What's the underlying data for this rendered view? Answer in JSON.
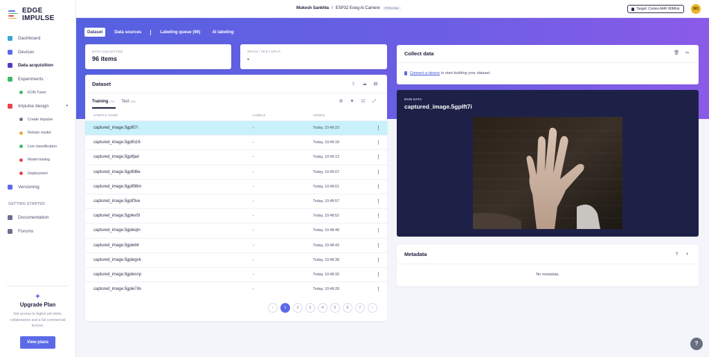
{
  "app": {
    "name": "EDGE IMPULSE"
  },
  "sidebar": {
    "items": [
      {
        "label": "Dashboard",
        "icon": "monitor-icon",
        "color": "#3aa6d9"
      },
      {
        "label": "Devices",
        "icon": "device-icon",
        "color": "#5b6be8"
      },
      {
        "label": "Data acquisition",
        "icon": "database-icon",
        "color": "#4b3fbf",
        "active": true
      },
      {
        "label": "Experiments",
        "icon": "table-icon",
        "color": "#3fb86b"
      },
      {
        "label": "EON Tuner",
        "icon": "eon-icon",
        "color": "#3fb86b",
        "sub": true
      },
      {
        "label": "Impulse design",
        "icon": "pulse-icon",
        "color": "#e8434b",
        "caret": "▾"
      },
      {
        "label": "Create impulse",
        "icon": "dot-icon",
        "color": "#6a6f8e",
        "sub": true
      },
      {
        "label": "Retrain model",
        "icon": "shuffle-icon",
        "color": "#e8a93a",
        "sub": true
      },
      {
        "label": "Live classification",
        "icon": "nodes-icon",
        "color": "#3fb86b",
        "sub": true
      },
      {
        "label": "Model testing",
        "icon": "clipboard-icon",
        "color": "#e8434b",
        "sub": true
      },
      {
        "label": "Deployment",
        "icon": "box-icon",
        "color": "#e8434b",
        "sub": true
      },
      {
        "label": "Versioning",
        "icon": "branch-icon",
        "color": "#5b6be8"
      }
    ],
    "section_label": "GETTING STARTED",
    "getting_started": [
      {
        "label": "Documentation",
        "icon": "book-icon"
      },
      {
        "label": "Forums",
        "icon": "chat-icon"
      }
    ],
    "upgrade": {
      "title": "Upgrade Plan",
      "text": "Get access to higher job limits, collaborators and a full commercial license.",
      "button": "View plans"
    }
  },
  "header": {
    "user": "Mukesh Sankhla",
    "separator": "/",
    "project": "ESP32 Eoeg Ai Camere",
    "badge": "PERSONAL",
    "target": "Target: Cortex-M4F 80MHz",
    "avatar_initials": "MS"
  },
  "tabs": [
    {
      "label": "Dataset",
      "active": true
    },
    {
      "label": "Data sources"
    },
    {
      "label": "Labeling queue (96)"
    },
    {
      "label": "AI labeling"
    }
  ],
  "stats": {
    "collected_label": "DATA COLLECTED",
    "collected_value": "96 items",
    "split_label": "TRAIN / TEST SPLIT",
    "split_value": "-"
  },
  "dataset": {
    "title": "Dataset",
    "training_label": "Training",
    "training_count": "(71)",
    "test_label": "Test",
    "test_count": "(15)",
    "columns": [
      "SAMPLE NAME",
      "LABELS",
      "ADDED"
    ],
    "rows": [
      {
        "name": "captured_image.5gplft7i",
        "label": "-",
        "added": "Today, 10:49:23",
        "selected": true
      },
      {
        "name": "captured_image.5gplfo16",
        "label": "-",
        "added": "Today, 10:49:18"
      },
      {
        "name": "captured_image.5gplfjad",
        "label": "-",
        "added": "Today, 10:49:13"
      },
      {
        "name": "captured_image.5gplfd6e",
        "label": "-",
        "added": "Today, 10:49:07"
      },
      {
        "name": "captured_image.5gplf88m",
        "label": "-",
        "added": "Today, 10:49:01"
      },
      {
        "name": "captured_image.5gplf3ve",
        "label": "-",
        "added": "Today, 10:48:57"
      },
      {
        "name": "captured_image.5gplev5l",
        "label": "-",
        "added": "Today, 10:48:52"
      },
      {
        "name": "captured_image.5gpleqtn",
        "label": "-",
        "added": "Today, 10:48:48"
      },
      {
        "name": "captured_image.5gplelt4",
        "label": "-",
        "added": "Today, 10:48:43"
      },
      {
        "name": "captured_image.5gplegvk",
        "label": "-",
        "added": "Today, 10:48:38"
      },
      {
        "name": "captured_image.5gplecnp",
        "label": "-",
        "added": "Today, 10:48:33"
      },
      {
        "name": "captured_image.5gple7dv",
        "label": "-",
        "added": "Today, 10:48:28"
      }
    ],
    "pager": {
      "prev": "‹",
      "pages": [
        "1",
        "2",
        "3",
        "4",
        "5",
        "6",
        "7"
      ],
      "next": "›",
      "current": "1"
    }
  },
  "collect": {
    "title": "Collect data",
    "link_text": "Connect a device",
    "text": " to start building your dataset."
  },
  "raw": {
    "label": "RAW DATA",
    "title": "captured_image.5gplft7i"
  },
  "metadata": {
    "title": "Metadata",
    "help": "?",
    "add": "+",
    "empty": "No metadata."
  },
  "help_button": "?"
}
